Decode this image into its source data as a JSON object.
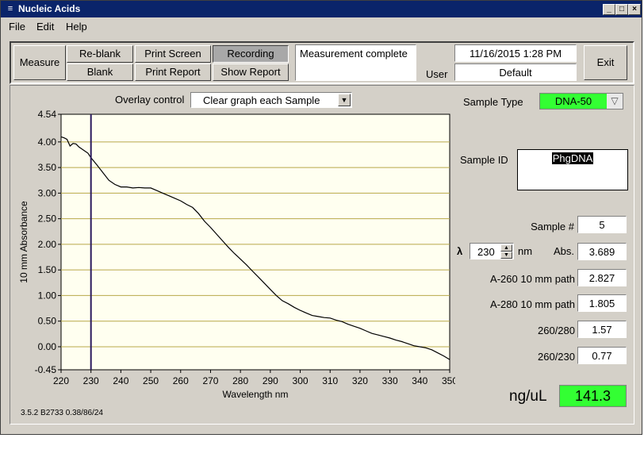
{
  "window": {
    "title": "Nucleic Acids"
  },
  "menu": {
    "file": "File",
    "edit": "Edit",
    "help": "Help"
  },
  "toolbar": {
    "measure": "Measure",
    "reblank": "Re-blank",
    "blank": "Blank",
    "print_screen": "Print Screen",
    "print_report": "Print Report",
    "recording": "Recording",
    "show_report": "Show Report",
    "status": "Measurement complete",
    "datetime": "11/16/2015  1:28 PM",
    "user_label": "User",
    "user_value": "Default",
    "exit": "Exit"
  },
  "overlay": {
    "label": "Overlay control",
    "value": "Clear graph each Sample"
  },
  "sample_type": {
    "label": "Sample Type",
    "value": "DNA-50",
    "color": "#33ff33"
  },
  "sample_id": {
    "label": "Sample ID",
    "value": "PhgDNA"
  },
  "sample_number": {
    "label": "Sample #",
    "value": "5"
  },
  "wavelength": {
    "symbol": "λ",
    "value": "230",
    "unit": "nm"
  },
  "abs": {
    "label": "Abs.",
    "value": "3.689"
  },
  "a260": {
    "label": "A-260 10 mm path",
    "value": "2.827"
  },
  "a280": {
    "label": "A-280 10 mm path",
    "value": "1.805"
  },
  "r260_280": {
    "label": "260/280",
    "value": "1.57"
  },
  "r260_230": {
    "label": "260/230",
    "value": "0.77"
  },
  "concentration": {
    "label": "ng/uL",
    "value": "141.3",
    "color": "#33ff33"
  },
  "version": "3.5.2 B2733 0.38/86/24",
  "chart_data": {
    "type": "line",
    "xlabel": "Wavelength nm",
    "ylabel": "10 mm Absorbance",
    "xlim": [
      220,
      350
    ],
    "ylim": [
      -0.45,
      4.54
    ],
    "xticks": [
      "220",
      "230",
      "240",
      "250",
      "260",
      "270",
      "280",
      "290",
      "300",
      "310",
      "320",
      "330",
      "340",
      "350"
    ],
    "yticks": [
      "4.54",
      "4.00",
      "3.50",
      "3.00",
      "2.50",
      "2.00",
      "1.50",
      "1.00",
      "0.50",
      "0.00",
      "-0.45"
    ],
    "cursor_x": 230,
    "grid": true,
    "series": [
      {
        "x": [
          220,
          221,
          222,
          223,
          224,
          225,
          226,
          227,
          228,
          229,
          230,
          232,
          234,
          236,
          238,
          240,
          242,
          244,
          246,
          248,
          250,
          252,
          254,
          256,
          258,
          260,
          262,
          264,
          266,
          268,
          270,
          272,
          274,
          276,
          278,
          280,
          282,
          284,
          286,
          288,
          290,
          292,
          294,
          296,
          298,
          300,
          302,
          304,
          306,
          308,
          310,
          312,
          314,
          316,
          318,
          320,
          322,
          324,
          326,
          328,
          330,
          332,
          334,
          336,
          338,
          340,
          342,
          344,
          346,
          348,
          350
        ],
        "y": [
          4.1,
          4.08,
          4.05,
          3.92,
          3.97,
          3.96,
          3.9,
          3.86,
          3.82,
          3.78,
          3.69,
          3.55,
          3.4,
          3.25,
          3.17,
          3.12,
          3.12,
          3.1,
          3.11,
          3.1,
          3.1,
          3.05,
          3.0,
          2.95,
          2.9,
          2.85,
          2.78,
          2.72,
          2.6,
          2.45,
          2.33,
          2.2,
          2.07,
          1.94,
          1.82,
          1.71,
          1.6,
          1.48,
          1.36,
          1.24,
          1.12,
          1.0,
          0.9,
          0.84,
          0.77,
          0.71,
          0.66,
          0.61,
          0.59,
          0.57,
          0.56,
          0.52,
          0.49,
          0.44,
          0.4,
          0.36,
          0.31,
          0.26,
          0.23,
          0.2,
          0.17,
          0.13,
          0.1,
          0.06,
          0.02,
          0.0,
          -0.02,
          -0.06,
          -0.12,
          -0.18,
          -0.25
        ]
      }
    ]
  }
}
